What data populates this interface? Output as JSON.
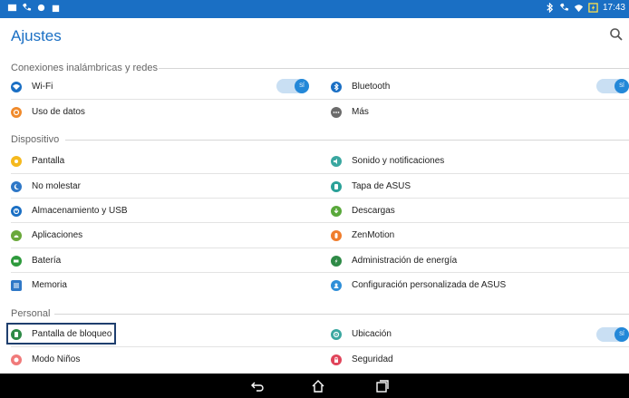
{
  "status_bar": {
    "time": "17:43"
  },
  "app_bar": {
    "title": "Ajustes"
  },
  "sections": {
    "wireless": "Conexiones inalámbricas y redes",
    "device": "Dispositivo",
    "personal": "Personal"
  },
  "items": {
    "wifi": "Wi-Fi",
    "bluetooth": "Bluetooth",
    "data_usage": "Uso de datos",
    "more": "Más",
    "display": "Pantalla",
    "sound": "Sonido y notificaciones",
    "dnd": "No molestar",
    "cover": "Tapa de ASUS",
    "storage": "Almacenamiento y USB",
    "downloads": "Descargas",
    "apps": "Aplicaciones",
    "zenmotion": "ZenMotion",
    "battery": "Batería",
    "power": "Administración de energía",
    "memory": "Memoria",
    "asus_custom": "Configuración personalizada de ASUS",
    "lockscreen": "Pantalla de bloqueo",
    "location": "Ubicación",
    "kids": "Modo Niños",
    "security": "Seguridad"
  },
  "toggle_label": "SÍ",
  "colors": {
    "status_bar": "#1a6fc4",
    "accent": "#1a6fc4",
    "toggle_knob": "#2488d8",
    "toggle_track": "#c9dff3",
    "highlight_border": "#1f3f6e"
  }
}
